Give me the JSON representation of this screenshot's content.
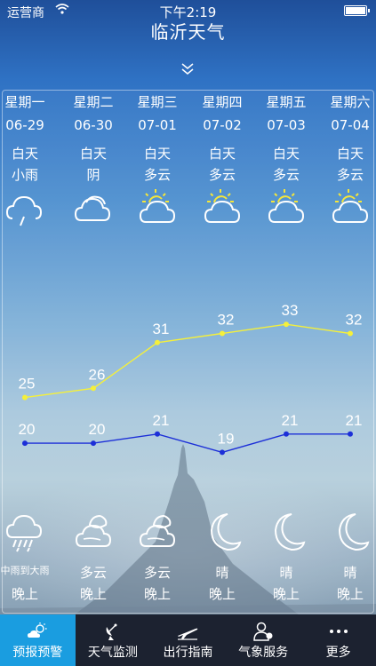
{
  "status": {
    "carrier": "运营商",
    "time": "下午2:19"
  },
  "title": "临沂天气",
  "days": [
    {
      "weekday": "星期一",
      "date": "06-29",
      "day_label": "白天",
      "day_weather": "小雨",
      "day_icon": "rain-cloud-icon",
      "night_weather": "中雨到大雨",
      "night_label": "晚上",
      "night_icon": "heavy-rain-cloud-icon"
    },
    {
      "weekday": "星期二",
      "date": "06-30",
      "day_label": "白天",
      "day_weather": "阴",
      "day_icon": "overcast-cloud-icon",
      "night_weather": "多云",
      "night_label": "晚上",
      "night_icon": "moon-cloud-icon"
    },
    {
      "weekday": "星期三",
      "date": "07-01",
      "day_label": "白天",
      "day_weather": "多云",
      "day_icon": "sun-cloud-icon",
      "night_weather": "多云",
      "night_label": "晚上",
      "night_icon": "moon-cloud-icon"
    },
    {
      "weekday": "星期四",
      "date": "07-02",
      "day_label": "白天",
      "day_weather": "多云",
      "day_icon": "sun-cloud-icon",
      "night_weather": "晴",
      "night_label": "晚上",
      "night_icon": "moon-icon"
    },
    {
      "weekday": "星期五",
      "date": "07-03",
      "day_label": "白天",
      "day_weather": "多云",
      "day_icon": "sun-cloud-icon",
      "night_weather": "晴",
      "night_label": "晚上",
      "night_icon": "moon-icon"
    },
    {
      "weekday": "星期六",
      "date": "07-04",
      "day_label": "白天",
      "day_weather": "多云",
      "day_icon": "sun-cloud-icon",
      "night_weather": "晴",
      "night_label": "晚上",
      "night_icon": "moon-icon"
    }
  ],
  "chart_data": {
    "type": "line",
    "categories": [
      "06-29",
      "06-30",
      "07-01",
      "07-02",
      "07-03",
      "07-04"
    ],
    "series": [
      {
        "values": [
          25,
          26,
          31,
          32,
          33,
          32
        ],
        "color": "#f5f03a"
      },
      {
        "values": [
          20,
          20,
          21,
          19,
          21,
          21
        ],
        "color": "#1c2fd8"
      }
    ]
  },
  "tabs": [
    {
      "label": "预报预警",
      "icon": "sun-cloud-icon",
      "active": true
    },
    {
      "label": "天气监测",
      "icon": "satellite-dish-icon",
      "active": false
    },
    {
      "label": "出行指南",
      "icon": "airplane-icon",
      "active": false
    },
    {
      "label": "气象服务",
      "icon": "user-service-icon",
      "active": false
    },
    {
      "label": "更多",
      "icon": "more-dots-icon",
      "active": false
    }
  ]
}
